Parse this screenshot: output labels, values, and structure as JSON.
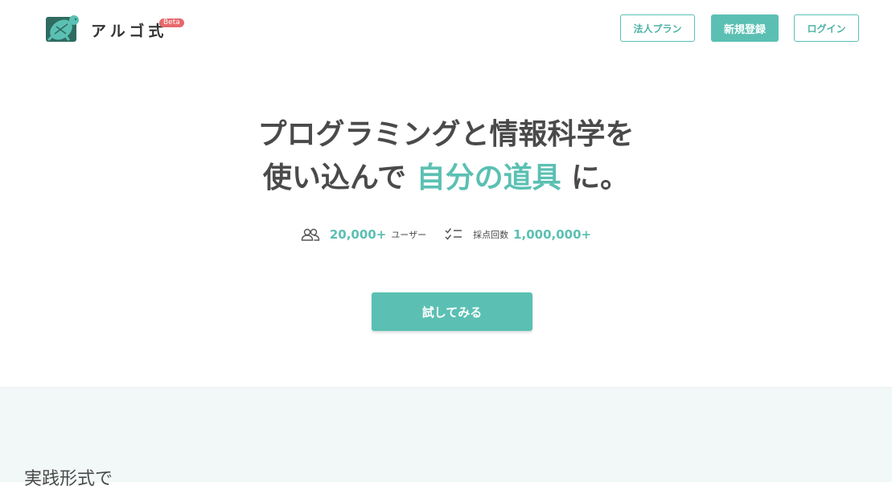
{
  "header": {
    "logo_text": "アルゴ式",
    "logo_badge": "Beta",
    "nav": {
      "corporate_label": "法人プラン",
      "signup_label": "新規登録",
      "login_label": "ログイン"
    }
  },
  "hero": {
    "line1": "プログラミングと情報科学を",
    "line2_prefix": "使い込んで",
    "line2_accent": "自分の道具",
    "line2_suffix": "に。"
  },
  "stats": {
    "users_icon": "users-icon",
    "users_value": "20,000+",
    "users_label": "ユーザー",
    "grading_icon": "checklist-icon",
    "grading_label": "採点回数",
    "grading_value": "1,000,000+"
  },
  "cta": {
    "label": "試してみる"
  },
  "section": {
    "title": "実践形式で"
  },
  "colors": {
    "accent": "#5bc0b3",
    "text": "#4a4a4a",
    "badge": "#e8676b",
    "section_bg": "#f2f8f7"
  }
}
